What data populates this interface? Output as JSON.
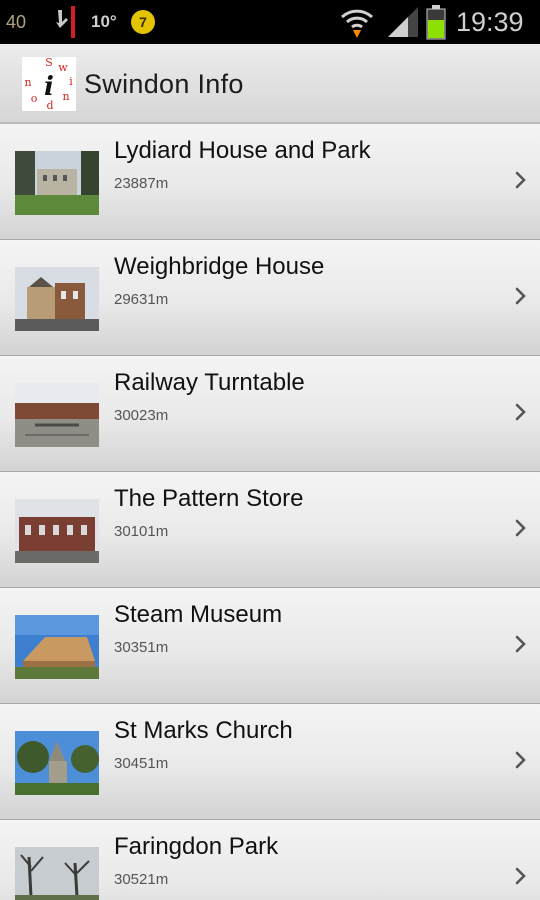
{
  "status_bar": {
    "left_number": "40",
    "temperature": "10°",
    "badge_number": "7",
    "time": "19:39",
    "icons": [
      "usb-icon",
      "badge-icon",
      "wifi-icon",
      "signal-icon",
      "battery-icon"
    ]
  },
  "app": {
    "title": "Swindon Info",
    "logo_letter": "i",
    "logo_ring_letters": "S w i n d o n",
    "logo_icon": "info-logo-icon"
  },
  "places": [
    {
      "name": "Lydiard House and Park",
      "distance": "23887m",
      "thumb": "lydiard-house-thumbnail"
    },
    {
      "name": "Weighbridge House",
      "distance": "29631m",
      "thumb": "weighbridge-house-thumbnail"
    },
    {
      "name": "Railway Turntable",
      "distance": "30023m",
      "thumb": "railway-turntable-thumbnail"
    },
    {
      "name": "The Pattern Store",
      "distance": "30101m",
      "thumb": "pattern-store-thumbnail"
    },
    {
      "name": "Steam Museum",
      "distance": "30351m",
      "thumb": "steam-museum-thumbnail"
    },
    {
      "name": "St Marks Church",
      "distance": "30451m",
      "thumb": "st-marks-church-thumbnail"
    },
    {
      "name": "Faringdon Park",
      "distance": "30521m",
      "thumb": "faringdon-park-thumbnail"
    }
  ],
  "colors": {
    "status_bar_bg": "#000000",
    "title_bar_bg": "#e2e2e2",
    "logo_red": "#d8231f",
    "badge_yellow": "#e4c300",
    "battery_green": "#8ee000"
  }
}
